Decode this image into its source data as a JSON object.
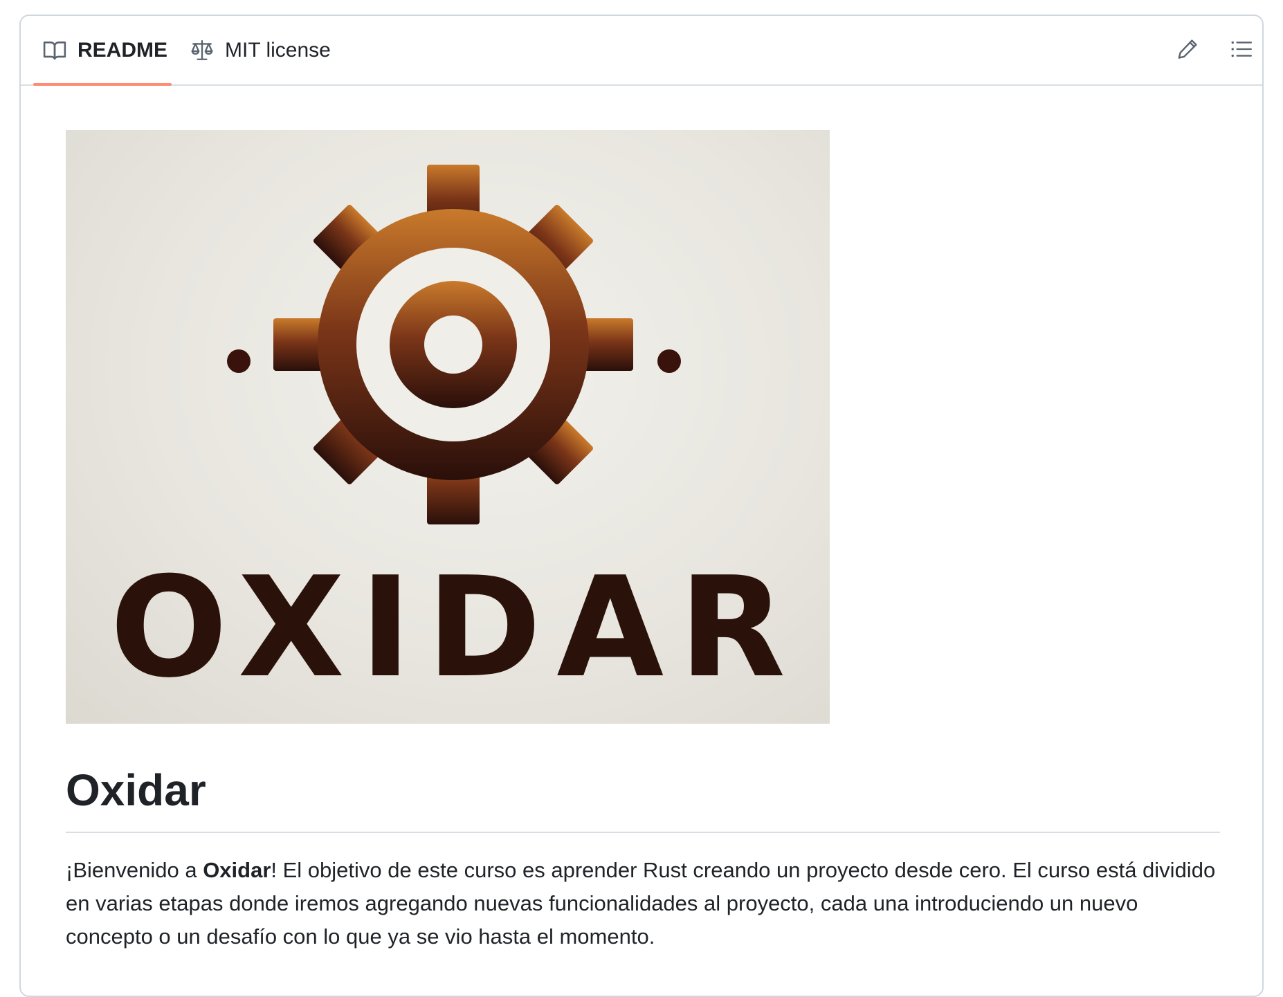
{
  "tabs": {
    "readme_label": "README",
    "license_label": "MIT license",
    "active": "README"
  },
  "toolbar": {
    "edit_icon": "pencil-icon",
    "outline_icon": "list-unordered-icon"
  },
  "readme": {
    "logo": {
      "alt_text": "OXIDAR",
      "gear_colors": [
        "#c97a2b",
        "#7a3518",
        "#2a0f0a"
      ]
    },
    "title": "Oxidar",
    "intro": {
      "prefix": "¡Bienvenido a ",
      "bold": "Oxidar",
      "suffix": "! El objetivo de este curso es aprender Rust creando un proyecto desde cero. El curso está dividido en varias etapas donde iremos agregando nuevas funcionalidades al proyecto, cada una introduciendo un nuevo concepto o un desafío con lo que ya se vio hasta el momento."
    }
  },
  "colors": {
    "accent_underline": "#fd8c73",
    "border": "#d0d7de",
    "text": "#1f2328"
  }
}
